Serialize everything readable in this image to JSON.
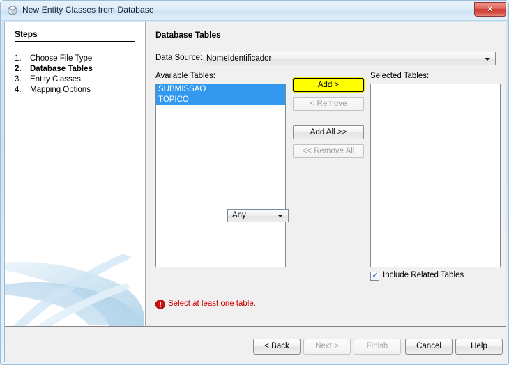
{
  "window": {
    "title": "New Entity Classes from Database",
    "icon": "cube-icon",
    "close_label": "x"
  },
  "steps": {
    "heading": "Steps",
    "items": [
      {
        "num": "1.",
        "label": "Choose File Type",
        "current": false
      },
      {
        "num": "2.",
        "label": "Database Tables",
        "current": true
      },
      {
        "num": "3.",
        "label": "Entity Classes",
        "current": false
      },
      {
        "num": "4.",
        "label": "Mapping Options",
        "current": false
      }
    ]
  },
  "content": {
    "heading": "Database Tables",
    "data_source": {
      "label": "Data Source:",
      "value": "NomeIdentificador"
    },
    "available": {
      "label": "Available Tables:",
      "items": [
        {
          "label": "SUBMISSAO",
          "selected": true
        },
        {
          "label": "TOPICO",
          "selected": true
        }
      ]
    },
    "selected": {
      "label": "Selected Tables:",
      "items": []
    },
    "transfer_buttons": [
      {
        "label": "Add >",
        "name": "add-button",
        "enabled": true,
        "highlighted": true
      },
      {
        "label": "< Remove",
        "name": "remove-button",
        "enabled": false,
        "highlighted": false
      },
      {
        "label": "Add All >>",
        "name": "add-all-button",
        "enabled": true,
        "highlighted": false
      },
      {
        "label": "<< Remove All",
        "name": "remove-all-button",
        "enabled": false,
        "highlighted": false
      }
    ],
    "filter_combo": {
      "value": "Any"
    },
    "include_related": {
      "label": "Include Related Tables",
      "checked": true,
      "tick": "✓"
    },
    "error": {
      "icon": "error-octagon-icon",
      "message": "Select at least one table."
    }
  },
  "footer": {
    "buttons": [
      {
        "id": "fb-back",
        "label": "< Back",
        "name": "back-button",
        "enabled": true
      },
      {
        "id": "fb-next",
        "label": "Next >",
        "name": "next-button",
        "enabled": false
      },
      {
        "id": "fb-finish",
        "label": "Finish",
        "name": "finish-button",
        "enabled": false
      },
      {
        "id": "fb-cancel",
        "label": "Cancel",
        "name": "cancel-button",
        "enabled": true
      },
      {
        "id": "fb-help",
        "label": "Help",
        "name": "help-button",
        "enabled": true
      }
    ]
  },
  "colors": {
    "selection_blue": "#3399ee",
    "highlight_yellow": "#ffff00",
    "error_red": "#cc0000"
  }
}
